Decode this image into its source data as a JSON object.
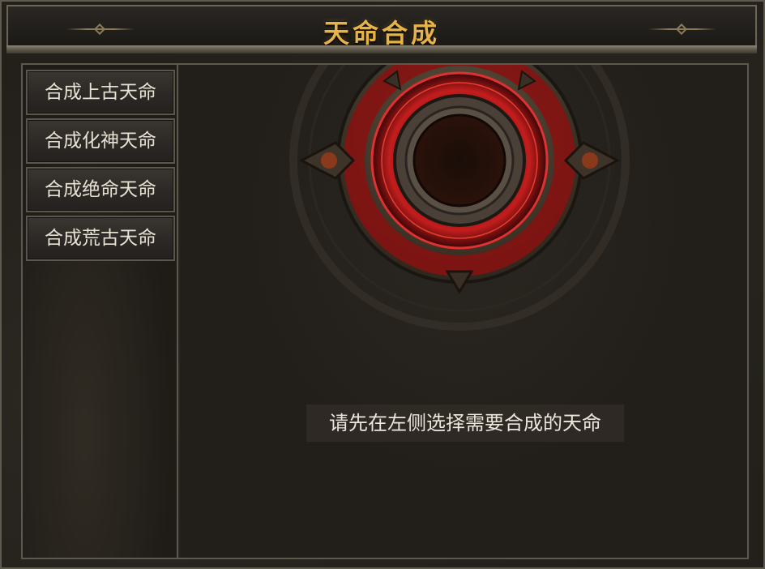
{
  "window": {
    "title": "天命合成"
  },
  "sidebar": {
    "items": [
      {
        "label": "合成上古天命"
      },
      {
        "label": "合成化神天命"
      },
      {
        "label": "合成绝命天命"
      },
      {
        "label": "合成荒古天命"
      }
    ]
  },
  "main": {
    "hint": "请先在左侧选择需要合成的天命",
    "slot_icon": "empty-fate-slot-icon"
  },
  "colors": {
    "title_gold": "#e6b34a",
    "ring_red": "#b01818",
    "frame_border": "#5d584d"
  }
}
